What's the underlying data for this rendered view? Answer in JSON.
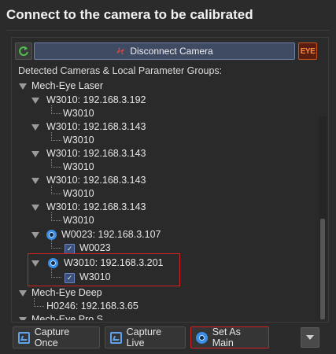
{
  "title": "Connect to the camera to be calibrated",
  "toolbar": {
    "disconnect_label": "Disconnect Camera",
    "eye_label": "EYE"
  },
  "tree_header": "Detected Cameras & Local Parameter Groups:",
  "tree": {
    "group_laser": "Mech-Eye Laser",
    "cams": [
      {
        "label": "W3010: 192.168.3.192",
        "param": "W3010"
      },
      {
        "label": "W3010: 192.168.3.143",
        "param": "W3010"
      },
      {
        "label": "W3010: 192.168.3.143",
        "param": "W3010"
      },
      {
        "label": "W3010: 192.168.3.143",
        "param": "W3010"
      },
      {
        "label": "W3010: 192.168.3.143",
        "param": "W3010"
      }
    ],
    "connected_w0023": {
      "label": "W0023: 192.168.3.107",
      "param": "W0023"
    },
    "connected_w3010": {
      "label": "W3010: 192.168.3.201",
      "param": "W3010"
    },
    "group_deep": "Mech-Eye Deep",
    "deep_cam": "H0246: 192.168.3.65",
    "group_pros": "Mech-Eye Pro S"
  },
  "buttons": {
    "capture_once": "Capture Once",
    "capture_live": "Capture Live",
    "set_as_main": "Set As Main"
  },
  "colors": {
    "accent_blue": "#3a8ee6",
    "highlight_red": "#d32222",
    "eye_orange": "#ff8a3a"
  }
}
